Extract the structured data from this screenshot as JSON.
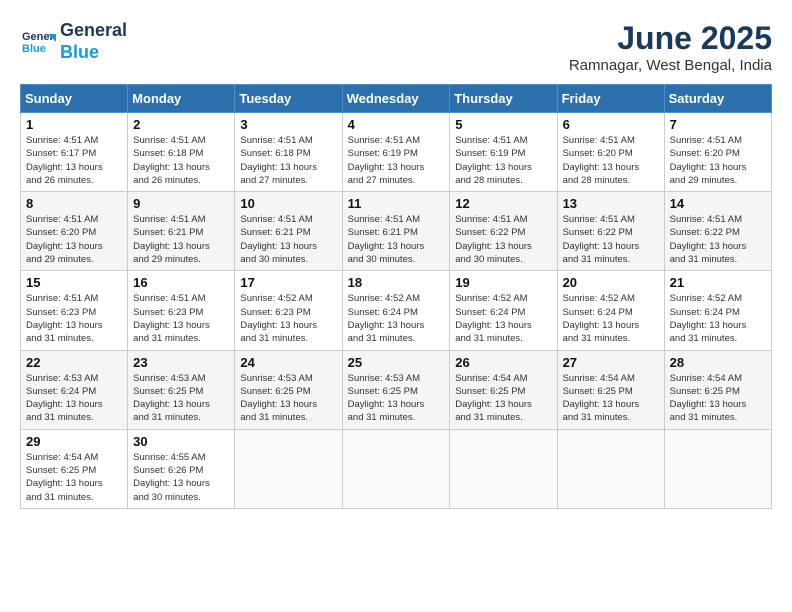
{
  "header": {
    "logo_line1": "General",
    "logo_line2": "Blue",
    "month": "June 2025",
    "location": "Ramnagar, West Bengal, India"
  },
  "weekdays": [
    "Sunday",
    "Monday",
    "Tuesday",
    "Wednesday",
    "Thursday",
    "Friday",
    "Saturday"
  ],
  "weeks": [
    [
      {
        "day": "1",
        "info": "Sunrise: 4:51 AM\nSunset: 6:17 PM\nDaylight: 13 hours\nand 26 minutes."
      },
      {
        "day": "2",
        "info": "Sunrise: 4:51 AM\nSunset: 6:18 PM\nDaylight: 13 hours\nand 26 minutes."
      },
      {
        "day": "3",
        "info": "Sunrise: 4:51 AM\nSunset: 6:18 PM\nDaylight: 13 hours\nand 27 minutes."
      },
      {
        "day": "4",
        "info": "Sunrise: 4:51 AM\nSunset: 6:19 PM\nDaylight: 13 hours\nand 27 minutes."
      },
      {
        "day": "5",
        "info": "Sunrise: 4:51 AM\nSunset: 6:19 PM\nDaylight: 13 hours\nand 28 minutes."
      },
      {
        "day": "6",
        "info": "Sunrise: 4:51 AM\nSunset: 6:20 PM\nDaylight: 13 hours\nand 28 minutes."
      },
      {
        "day": "7",
        "info": "Sunrise: 4:51 AM\nSunset: 6:20 PM\nDaylight: 13 hours\nand 29 minutes."
      }
    ],
    [
      {
        "day": "8",
        "info": "Sunrise: 4:51 AM\nSunset: 6:20 PM\nDaylight: 13 hours\nand 29 minutes."
      },
      {
        "day": "9",
        "info": "Sunrise: 4:51 AM\nSunset: 6:21 PM\nDaylight: 13 hours\nand 29 minutes."
      },
      {
        "day": "10",
        "info": "Sunrise: 4:51 AM\nSunset: 6:21 PM\nDaylight: 13 hours\nand 30 minutes."
      },
      {
        "day": "11",
        "info": "Sunrise: 4:51 AM\nSunset: 6:21 PM\nDaylight: 13 hours\nand 30 minutes."
      },
      {
        "day": "12",
        "info": "Sunrise: 4:51 AM\nSunset: 6:22 PM\nDaylight: 13 hours\nand 30 minutes."
      },
      {
        "day": "13",
        "info": "Sunrise: 4:51 AM\nSunset: 6:22 PM\nDaylight: 13 hours\nand 31 minutes."
      },
      {
        "day": "14",
        "info": "Sunrise: 4:51 AM\nSunset: 6:22 PM\nDaylight: 13 hours\nand 31 minutes."
      }
    ],
    [
      {
        "day": "15",
        "info": "Sunrise: 4:51 AM\nSunset: 6:23 PM\nDaylight: 13 hours\nand 31 minutes."
      },
      {
        "day": "16",
        "info": "Sunrise: 4:51 AM\nSunset: 6:23 PM\nDaylight: 13 hours\nand 31 minutes."
      },
      {
        "day": "17",
        "info": "Sunrise: 4:52 AM\nSunset: 6:23 PM\nDaylight: 13 hours\nand 31 minutes."
      },
      {
        "day": "18",
        "info": "Sunrise: 4:52 AM\nSunset: 6:24 PM\nDaylight: 13 hours\nand 31 minutes."
      },
      {
        "day": "19",
        "info": "Sunrise: 4:52 AM\nSunset: 6:24 PM\nDaylight: 13 hours\nand 31 minutes."
      },
      {
        "day": "20",
        "info": "Sunrise: 4:52 AM\nSunset: 6:24 PM\nDaylight: 13 hours\nand 31 minutes."
      },
      {
        "day": "21",
        "info": "Sunrise: 4:52 AM\nSunset: 6:24 PM\nDaylight: 13 hours\nand 31 minutes."
      }
    ],
    [
      {
        "day": "22",
        "info": "Sunrise: 4:53 AM\nSunset: 6:24 PM\nDaylight: 13 hours\nand 31 minutes."
      },
      {
        "day": "23",
        "info": "Sunrise: 4:53 AM\nSunset: 6:25 PM\nDaylight: 13 hours\nand 31 minutes."
      },
      {
        "day": "24",
        "info": "Sunrise: 4:53 AM\nSunset: 6:25 PM\nDaylight: 13 hours\nand 31 minutes."
      },
      {
        "day": "25",
        "info": "Sunrise: 4:53 AM\nSunset: 6:25 PM\nDaylight: 13 hours\nand 31 minutes."
      },
      {
        "day": "26",
        "info": "Sunrise: 4:54 AM\nSunset: 6:25 PM\nDaylight: 13 hours\nand 31 minutes."
      },
      {
        "day": "27",
        "info": "Sunrise: 4:54 AM\nSunset: 6:25 PM\nDaylight: 13 hours\nand 31 minutes."
      },
      {
        "day": "28",
        "info": "Sunrise: 4:54 AM\nSunset: 6:25 PM\nDaylight: 13 hours\nand 31 minutes."
      }
    ],
    [
      {
        "day": "29",
        "info": "Sunrise: 4:54 AM\nSunset: 6:25 PM\nDaylight: 13 hours\nand 31 minutes."
      },
      {
        "day": "30",
        "info": "Sunrise: 4:55 AM\nSunset: 6:26 PM\nDaylight: 13 hours\nand 30 minutes."
      },
      {
        "day": "",
        "info": ""
      },
      {
        "day": "",
        "info": ""
      },
      {
        "day": "",
        "info": ""
      },
      {
        "day": "",
        "info": ""
      },
      {
        "day": "",
        "info": ""
      }
    ]
  ]
}
